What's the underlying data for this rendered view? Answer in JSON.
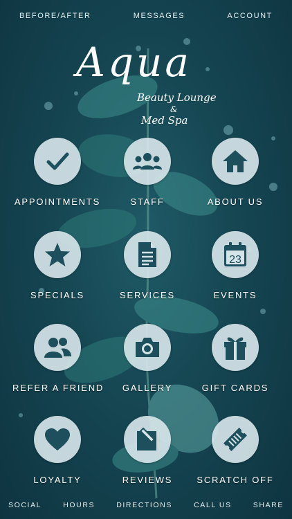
{
  "top_nav": [
    "BEFORE/AFTER",
    "MESSAGES",
    "ACCOUNT"
  ],
  "logo": {
    "name": "Aqua",
    "tagline_1": "Beauty Lounge",
    "tagline_amp": "&",
    "tagline_2": "Med Spa"
  },
  "tiles": [
    {
      "label": "APPOINTMENTS",
      "icon": "checkmark-icon"
    },
    {
      "label": "STAFF",
      "icon": "people-icon"
    },
    {
      "label": "ABOUT US",
      "icon": "home-icon"
    },
    {
      "label": "SPECIALS",
      "icon": "star-icon"
    },
    {
      "label": "SERVICES",
      "icon": "document-icon"
    },
    {
      "label": "EVENTS",
      "icon": "calendar-icon",
      "icon_text": "23"
    },
    {
      "label": "REFER A FRIEND",
      "icon": "refer-friend-icon"
    },
    {
      "label": "GALLERY",
      "icon": "camera-icon"
    },
    {
      "label": "GIFT CARDS",
      "icon": "gift-icon"
    },
    {
      "label": "LOYALTY",
      "icon": "heart-icon"
    },
    {
      "label": "REVIEWS",
      "icon": "edit-review-icon"
    },
    {
      "label": "SCRATCH OFF",
      "icon": "ticket-icon"
    }
  ],
  "bottom_nav": [
    "SOCIAL",
    "HOURS",
    "DIRECTIONS",
    "CALL US",
    "SHARE"
  ],
  "colors": {
    "background": "#154652",
    "circle": "#d5e4e8",
    "icon": "#1d4f5c",
    "leaf": "#3f8f8c"
  }
}
